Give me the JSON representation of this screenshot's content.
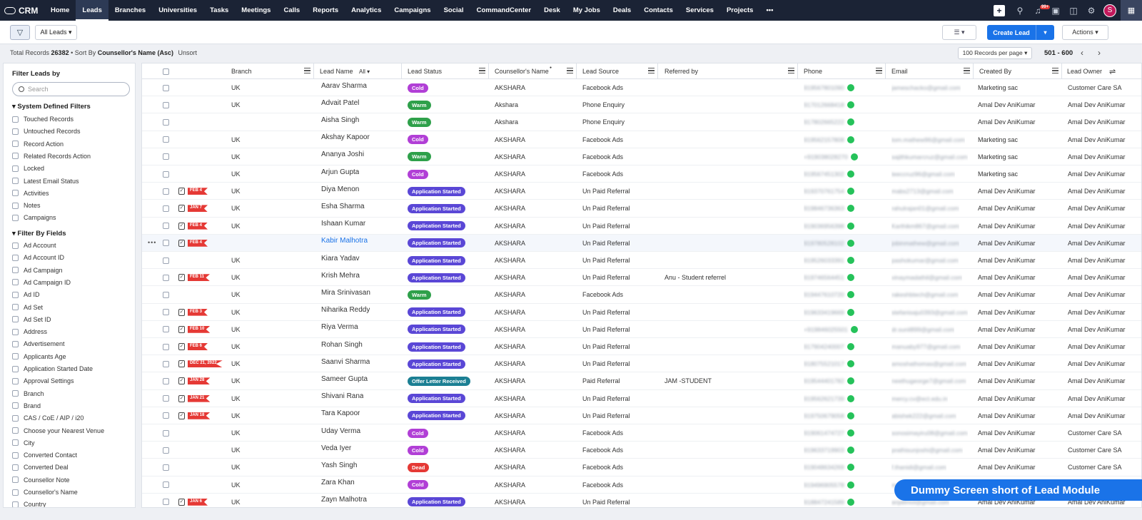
{
  "app": {
    "name": "CRM"
  },
  "nav": {
    "items": [
      "Home",
      "Leads",
      "Branches",
      "Universities",
      "Tasks",
      "Meetings",
      "Calls",
      "Reports",
      "Analytics",
      "Campaigns",
      "Social",
      "CommandCenter",
      "Desk",
      "My Jobs",
      "Deals",
      "Contacts",
      "Services",
      "Projects",
      "•••"
    ],
    "active": "Leads",
    "notif_badge": "99+",
    "avatar_letter": "S"
  },
  "toolbar": {
    "view_select": "All Leads ▾",
    "view_toggle": "☰  ▾",
    "create_label": "Create Lead",
    "create_dd": "▾",
    "actions_label": "Actions  ▾"
  },
  "info": {
    "total_label": "Total Records",
    "total": "26382",
    "sort_prefix": "• Sort By",
    "sort_by": "Counsellor's Name (Asc)",
    "unsort": "Unsort",
    "per_page": "100 Records per page ▾",
    "range": "501 - 600",
    "prev": "‹",
    "next": "›"
  },
  "sidebar": {
    "title": "Filter Leads by",
    "search_placeholder": "Search",
    "system_title": "▾  System Defined Filters",
    "system_filters": [
      "Touched Records",
      "Untouched Records",
      "Record Action",
      "Related Records Action",
      "Locked",
      "Latest Email Status",
      "Activities",
      "Notes",
      "Campaigns"
    ],
    "fields_title": "▾  Filter By Fields",
    "field_filters": [
      "Ad Account",
      "Ad Account ID",
      "Ad Campaign",
      "Ad Campaign ID",
      "Ad ID",
      "Ad Set",
      "Ad Set ID",
      "Address",
      "Advertisement",
      "Applicants Age",
      "Application Started Date",
      "Approval Settings",
      "Branch",
      "Brand",
      "CAS / CoE / AIP / i20",
      "Choose your Nearest Venue",
      "City",
      "Converted Contact",
      "Converted Deal",
      "Counsellor Note",
      "Counsellor's Name",
      "Country"
    ]
  },
  "table": {
    "headers": {
      "branch": "Branch",
      "lead_name": "Lead Name",
      "lead_name_filter": "All ▾",
      "lead_status": "Lead Status",
      "counsellor": "Counsellor's Name",
      "counsellor_mark": "●",
      "lead_source": "Lead Source",
      "referred_by": "Referred by",
      "phone": "Phone",
      "email": "Email",
      "created_by": "Created By",
      "lead_owner": "Lead Owner"
    },
    "status_colors": {
      "Cold": "#b13fd6",
      "Warm": "#2ea04a",
      "Application Started": "#5a47d6",
      "Offer Letter Received": "#1b7f93",
      "Dead": "#e53935"
    },
    "rows": [
      {
        "branch": "UK",
        "name": "Aarav Sharma",
        "status": "Cold",
        "counsellor": "AKSHARA",
        "source": "Facebook Ads",
        "referred": "",
        "phone": "919567801090",
        "email": "jameschacko@gmail.com",
        "created": "Marketing sac",
        "owner": "Customer Care SA"
      },
      {
        "branch": "UK",
        "name": "Advait Patel",
        "status": "Warm",
        "counsellor": "Akshara",
        "source": "Phone Enquiry",
        "referred": "",
        "phone": "917012668418",
        "email": "",
        "created": "Amal Dev AniKumar",
        "owner": "Amal Dev AniKumar"
      },
      {
        "branch": "",
        "name": "Aisha Singh",
        "status": "Warm",
        "counsellor": "Akshara",
        "source": "Phone Enquiry",
        "referred": "",
        "phone": "917802665222",
        "email": "",
        "created": "Amal Dev AniKumar",
        "owner": "Amal Dev AniKumar"
      },
      {
        "branch": "UK",
        "name": "Akshay Kapoor",
        "status": "Cold",
        "counsellor": "AKSHARA",
        "source": "Facebook Ads",
        "referred": "",
        "phone": "919562157808",
        "email": "tom.mathew96@gmail.com",
        "created": "Marketing sac",
        "owner": "Amal Dev AniKumar"
      },
      {
        "branch": "UK",
        "name": "Ananya Joshi",
        "status": "Warm",
        "counsellor": "AKSHARA",
        "source": "Facebook Ads",
        "referred": "",
        "phone": "+919038028270",
        "email": "sajithkumarcruz@gmail.com",
        "created": "Marketing sac",
        "owner": "Amal Dev AniKumar"
      },
      {
        "branch": "UK",
        "name": "Arjun Gupta",
        "status": "Cold",
        "counsellor": "AKSHARA",
        "source": "Facebook Ads",
        "referred": "",
        "phone": "919567451302",
        "email": "teeccruz96@gmail.com",
        "created": "Marketing sac",
        "owner": "Amal Dev AniKumar"
      },
      {
        "branch": "UK",
        "name": "Diya Menon",
        "status": "Application Started",
        "task": true,
        "flag": "FEB 4",
        "counsellor": "AKSHARA",
        "source": "Un Paid Referral",
        "referred": "",
        "phone": "919370761754",
        "email": "mabs2713@gmail.com",
        "created": "Amal Dev AniKumar",
        "owner": "Amal Dev AniKumar"
      },
      {
        "branch": "UK",
        "name": "Esha Sharma",
        "status": "Application Started",
        "task": true,
        "flag": "JAN 7",
        "counsellor": "AKSHARA",
        "source": "Un Paid Referral",
        "referred": "",
        "phone": "919846736363",
        "email": "rahulrajan01@gmail.com",
        "created": "Amal Dev AniKumar",
        "owner": "Amal Dev AniKumar"
      },
      {
        "branch": "UK",
        "name": "Ishaan Kumar",
        "status": "Application Started",
        "task": true,
        "flag": "FEB 4",
        "counsellor": "AKSHARA",
        "source": "Un Paid Referral",
        "referred": "",
        "phone": "919036956398",
        "email": "Karthikm867@gmail.com",
        "created": "Amal Dev AniKumar",
        "owner": "Amal Dev AniKumar"
      },
      {
        "branch": "",
        "name": "Kabir Malhotra",
        "status": "Application Started",
        "task": true,
        "flag": "FEB 4",
        "link": true,
        "hl": true,
        "counsellor": "AKSHARA",
        "source": "Un Paid Referral",
        "referred": "",
        "phone": "919780528102",
        "email": "jobinmathew@gmail.com",
        "created": "Amal Dev AniKumar",
        "owner": "Amal Dev AniKumar"
      },
      {
        "branch": "UK",
        "name": "Kiara Yadav",
        "status": "Application Started",
        "counsellor": "AKSHARA",
        "source": "Un Paid Referral",
        "referred": "",
        "phone": "919526033391",
        "email": "pashokumar@gmail.com",
        "created": "Amal Dev AniKumar",
        "owner": "Amal Dev AniKumar"
      },
      {
        "branch": "UK",
        "name": "Krish Mehra",
        "status": "Application Started",
        "task": true,
        "flag": "FEB 11",
        "counsellor": "AKSHARA",
        "source": "Un Paid Referral",
        "referred": "Anu - Student referrel",
        "phone": "919746564451",
        "email": "vinaymadathil@gmail.com",
        "created": "Amal Dev AniKumar",
        "owner": "Amal Dev AniKumar"
      },
      {
        "branch": "UK",
        "name": "Mira Srinivasan",
        "status": "Warm",
        "counsellor": "AKSHARA",
        "source": "Facebook Ads",
        "referred": "",
        "phone": "919447610720",
        "email": "rakeshbtech@gmail.com",
        "created": "Amal Dev AniKumar",
        "owner": "Amal Dev AniKumar"
      },
      {
        "branch": "UK",
        "name": "Niharika Reddy",
        "status": "Application Started",
        "task": true,
        "flag": "FEB 3",
        "counsellor": "AKSHARA",
        "source": "Un Paid Referral",
        "referred": "",
        "phone": "919633419669",
        "email": "stefanisaju0393@gmail.com",
        "created": "Amal Dev AniKumar",
        "owner": "Amal Dev AniKumar"
      },
      {
        "branch": "UK",
        "name": "Riya Verma",
        "status": "Application Started",
        "task": true,
        "flag": "FEB 10",
        "counsellor": "AKSHARA",
        "source": "Un Paid Referral",
        "referred": "",
        "phone": "+919846025501",
        "email": "dr.sunil899@gmail.com",
        "created": "Amal Dev AniKumar",
        "owner": "Amal Dev AniKumar"
      },
      {
        "branch": "UK",
        "name": "Rohan Singh",
        "status": "Application Started",
        "task": true,
        "flag": "FEB 6",
        "counsellor": "AKSHARA",
        "source": "Un Paid Referral",
        "referred": "",
        "phone": "917904240007",
        "email": "manuaby977@gmail.com",
        "created": "Amal Dev AniKumar",
        "owner": "Amal Dev AniKumar"
      },
      {
        "branch": "UK",
        "name": "Saanvi Sharma",
        "status": "Application Started",
        "task": true,
        "flag": "DEC 21, 2022",
        "counsellor": "AKSHARA",
        "source": "Un Paid Referral",
        "referred": "",
        "phone": "918075521017",
        "email": "amoshathomas@gmail.com",
        "created": "Amal Dev AniKumar",
        "owner": "Amal Dev AniKumar"
      },
      {
        "branch": "UK",
        "name": "Sameer Gupta",
        "status": "Offer Letter Received",
        "task": true,
        "flag": "JAN 28",
        "counsellor": "AKSHARA",
        "source": "Paid Referral",
        "referred": "JAM  -STUDENT",
        "phone": "919544401782",
        "email": "neethugeorge7@gmail.com",
        "created": "Amal Dev AniKumar",
        "owner": "Amal Dev AniKumar"
      },
      {
        "branch": "UK",
        "name": "Shivani Rana",
        "status": "Application Started",
        "task": true,
        "flag": "JAN 21",
        "counsellor": "AKSHARA",
        "source": "Un Paid Referral",
        "referred": "",
        "phone": "919562621739",
        "email": "mercy.cv@ect.edu.in",
        "created": "Amal Dev AniKumar",
        "owner": "Amal Dev AniKumar"
      },
      {
        "branch": "UK",
        "name": "Tara Kapoor",
        "status": "Application Started",
        "task": true,
        "flag": "JAN 18",
        "counsellor": "AKSHARA",
        "source": "Un Paid Referral",
        "referred": "",
        "phone": "919750679058",
        "email": "abishek222@gmail.com",
        "created": "Amal Dev AniKumar",
        "owner": "Amal Dev AniKumar"
      },
      {
        "branch": "UK",
        "name": "Uday Verma",
        "status": "Cold",
        "counsellor": "AKSHARA",
        "source": "Facebook Ads",
        "referred": "",
        "phone": "919061474727",
        "email": "sonosimayiru08@gmail.com",
        "created": "Amal Dev AniKumar",
        "owner": "Customer Care SA"
      },
      {
        "branch": "UK",
        "name": "Veda Iyer",
        "status": "Cold",
        "counsellor": "AKSHARA",
        "source": "Facebook Ads",
        "referred": "",
        "phone": "919633719903",
        "email": "prathisunjoshi@gmail.com",
        "created": "Amal Dev AniKumar",
        "owner": "Customer Care SA"
      },
      {
        "branch": "UK",
        "name": "Yash Singh",
        "status": "Dead",
        "counsellor": "AKSHARA",
        "source": "Facebook Ads",
        "referred": "",
        "phone": "919048634269",
        "email": "f.thanidi@gmail.com",
        "created": "Amal Dev AniKumar",
        "owner": "Customer Care SA"
      },
      {
        "branch": "UK",
        "name": "Zara Khan",
        "status": "Cold",
        "counsellor": "AKSHARA",
        "source": "Facebook Ads",
        "referred": "",
        "phone": "919496905578",
        "email": "mathewjohn@gmail.com",
        "created": "Amal Dev AniKumar",
        "owner": "Customer Care SA"
      },
      {
        "branch": "UK",
        "name": "Zayn Malhotra",
        "status": "Application Started",
        "task": true,
        "flag": "JAN 6",
        "counsellor": "AKSHARA",
        "source": "Un Paid Referral",
        "referred": "",
        "phone": "918847241589",
        "email": "anjalimol@gmail.com",
        "created": "Amal Dev AniKumar",
        "owner": "Amal Dev AniKumar"
      }
    ]
  },
  "watermark": "Dummy Screen short of Lead Module"
}
